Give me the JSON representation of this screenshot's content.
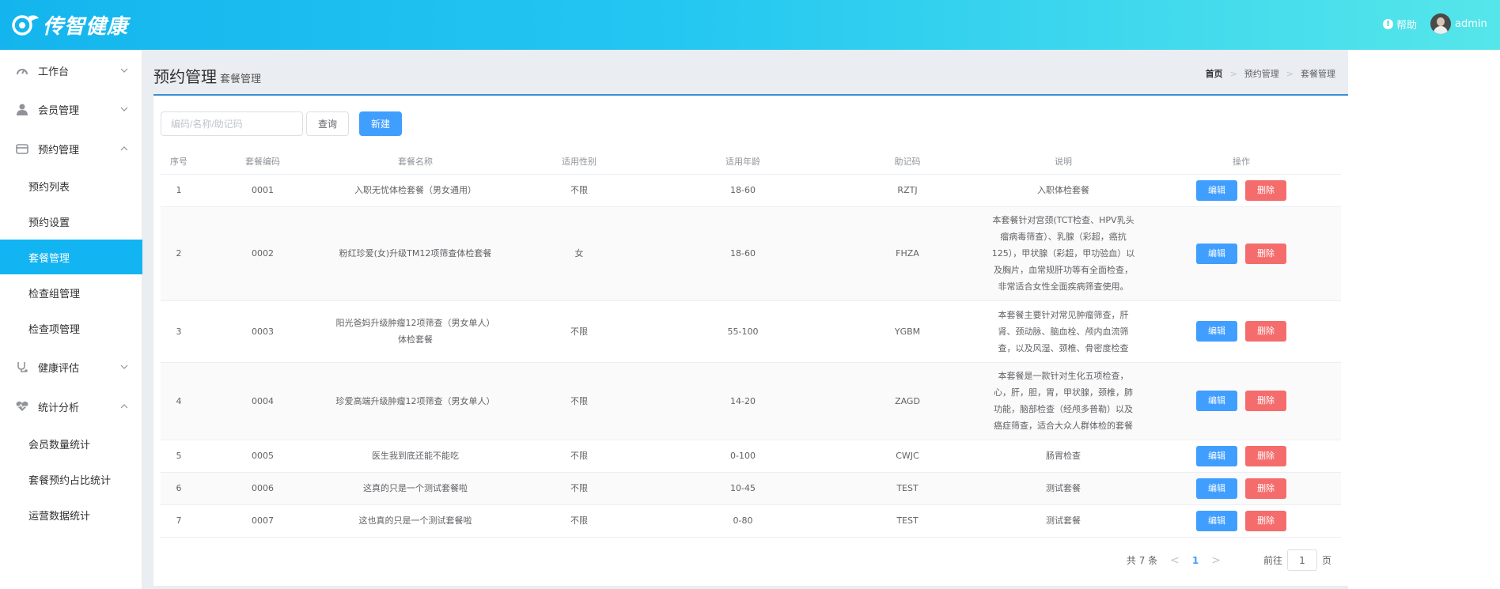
{
  "header": {
    "logo_text": "传智健康",
    "help_label": "帮助",
    "user_name": "admin"
  },
  "sidebar": {
    "groups": [
      {
        "label": "工作台",
        "icon": "dashboard-icon",
        "expanded": false
      },
      {
        "label": "会员管理",
        "icon": "user-icon",
        "expanded": false
      },
      {
        "label": "预约管理",
        "icon": "calendar-icon",
        "expanded": true
      },
      {
        "label": "健康评估",
        "icon": "stethoscope-icon",
        "expanded": false
      },
      {
        "label": "统计分析",
        "icon": "heartbeat-icon",
        "expanded": true
      }
    ],
    "items": [
      {
        "label": "预约列表",
        "active": false
      },
      {
        "label": "预约设置",
        "active": false
      },
      {
        "label": "套餐管理",
        "active": true
      },
      {
        "label": "检查组管理",
        "active": false
      },
      {
        "label": "检查项管理",
        "active": false
      },
      {
        "label": "会员数量统计",
        "active": false
      },
      {
        "label": "套餐预约占比统计",
        "active": false
      },
      {
        "label": "运营数据统计",
        "active": false
      }
    ]
  },
  "page": {
    "title": "预约管理",
    "subtitle": "套餐管理",
    "breadcrumb": [
      "首页",
      "预约管理",
      "套餐管理"
    ]
  },
  "toolbar": {
    "search_placeholder": "编码/名称/助记码",
    "query_label": "查询",
    "new_label": "新建"
  },
  "table": {
    "columns": [
      "序号",
      "套餐编码",
      "套餐名称",
      "适用性别",
      "适用年龄",
      "助记码",
      "说明",
      "操作"
    ],
    "edit_label": "编辑",
    "delete_label": "删除",
    "rows": [
      {
        "no": "1",
        "code": "0001",
        "name": "入职无忧体检套餐（男女通用）",
        "sex": "不限",
        "age": "18-60",
        "mnemonic": "RZTJ",
        "desc": "入职体检套餐"
      },
      {
        "no": "2",
        "code": "0002",
        "name": "粉红珍爱(女)升级TM12项筛查体检套餐",
        "sex": "女",
        "age": "18-60",
        "mnemonic": "FHZA",
        "desc": "本套餐针对宫颈(TCT检查、HPV乳头瘤病毒筛查）、乳腺（彩超，癌抗125），甲状腺（彩超，甲功验血）以及胸片，血常规肝功等有全面检查，非常适合女性全面疾病筛查使用。"
      },
      {
        "no": "3",
        "code": "0003",
        "name": "阳光爸妈升级肿瘤12项筛查（男女单人）体检套餐",
        "sex": "不限",
        "age": "55-100",
        "mnemonic": "YGBM",
        "desc": "本套餐主要针对常见肿瘤筛查，肝肾、颈动脉、脑血栓、颅内血流筛查，以及风湿、颈椎、骨密度检查"
      },
      {
        "no": "4",
        "code": "0004",
        "name": "珍爱高端升级肿瘤12项筛查（男女单人）",
        "sex": "不限",
        "age": "14-20",
        "mnemonic": "ZAGD",
        "desc": "本套餐是一款针对生化五项检查，心，肝，胆，胃，甲状腺，颈椎，肺功能，脑部检查（经颅多普勒）以及癌症筛查，适合大众人群体检的套餐"
      },
      {
        "no": "5",
        "code": "0005",
        "name": "医生我到底还能不能吃",
        "sex": "不限",
        "age": "0-100",
        "mnemonic": "CWJC",
        "desc": "肠胃检查"
      },
      {
        "no": "6",
        "code": "0006",
        "name": "这真的只是一个测试套餐啦",
        "sex": "不限",
        "age": "10-45",
        "mnemonic": "TEST",
        "desc": "测试套餐"
      },
      {
        "no": "7",
        "code": "0007",
        "name": "这也真的只是一个测试套餐啦",
        "sex": "不限",
        "age": "0-80",
        "mnemonic": "TEST",
        "desc": "测试套餐"
      }
    ]
  },
  "pagination": {
    "total_text": "共 7 条",
    "current_page": "1",
    "goto_label": "前往",
    "goto_value": "1",
    "page_suffix": "页"
  }
}
